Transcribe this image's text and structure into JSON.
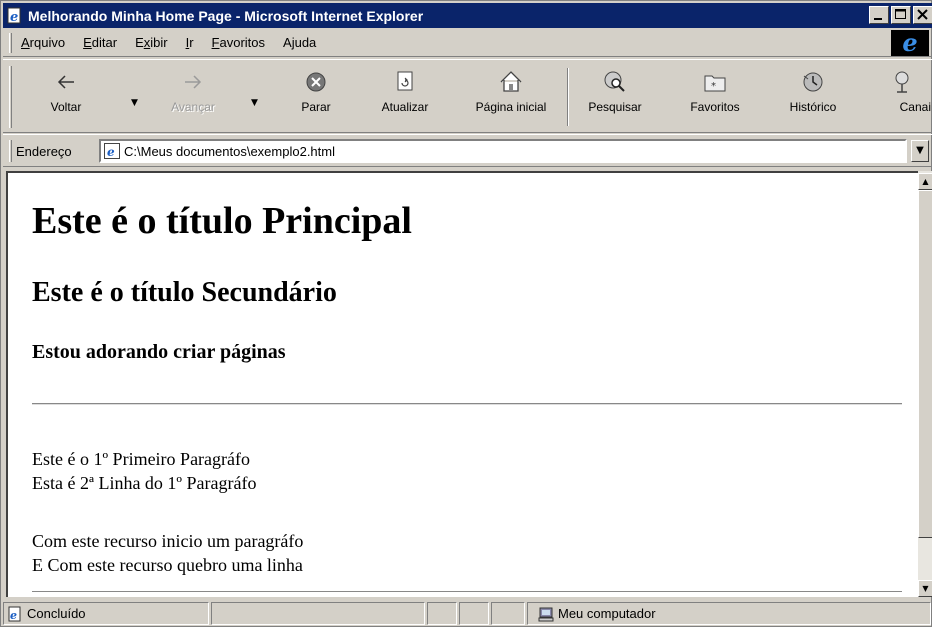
{
  "window": {
    "title": "Melhorando Minha Home Page - Microsoft Internet Explorer"
  },
  "menu": {
    "items": [
      {
        "label": "Arquivo",
        "accel": "A",
        "rest": "rquivo"
      },
      {
        "label": "Editar",
        "accel": "E",
        "rest": "ditar"
      },
      {
        "label": "Exibir",
        "accel": "x",
        "pre": "E",
        "rest": "ibir"
      },
      {
        "label": "Ir",
        "accel": "I",
        "rest": "r"
      },
      {
        "label": "Favoritos",
        "accel": "F",
        "rest": "avoritos"
      },
      {
        "label": "Ajuda",
        "accel": "j",
        "pre": "A",
        "rest": "uda"
      }
    ]
  },
  "toolbar": {
    "back": "Voltar",
    "forward": "Avançar",
    "stop": "Parar",
    "refresh": "Atualizar",
    "home": "Página inicial",
    "search": "Pesquisar",
    "favorites": "Favoritos",
    "history": "Histórico",
    "channels": "Canais"
  },
  "address": {
    "label": "Endereço",
    "value": "C:\\Meus documentos\\exemplo2.html"
  },
  "page": {
    "h1": "Este é o título Principal",
    "h2": "Este é o título Secundário",
    "h3": "Estou adorando criar páginas",
    "p1_line1": "Este é o 1º Primeiro Paragráfo",
    "p1_line2": "Esta é 2ª Linha do 1º Paragráfo",
    "p2_line1": "Com este recurso inicio um paragráfo",
    "p2_line2": "E Com este recurso quebro uma linha"
  },
  "status": {
    "text": "Concluído",
    "zone": "Meu computador"
  },
  "colors": {
    "titlebar": "#0a246a",
    "chrome": "#d4d0c8"
  }
}
